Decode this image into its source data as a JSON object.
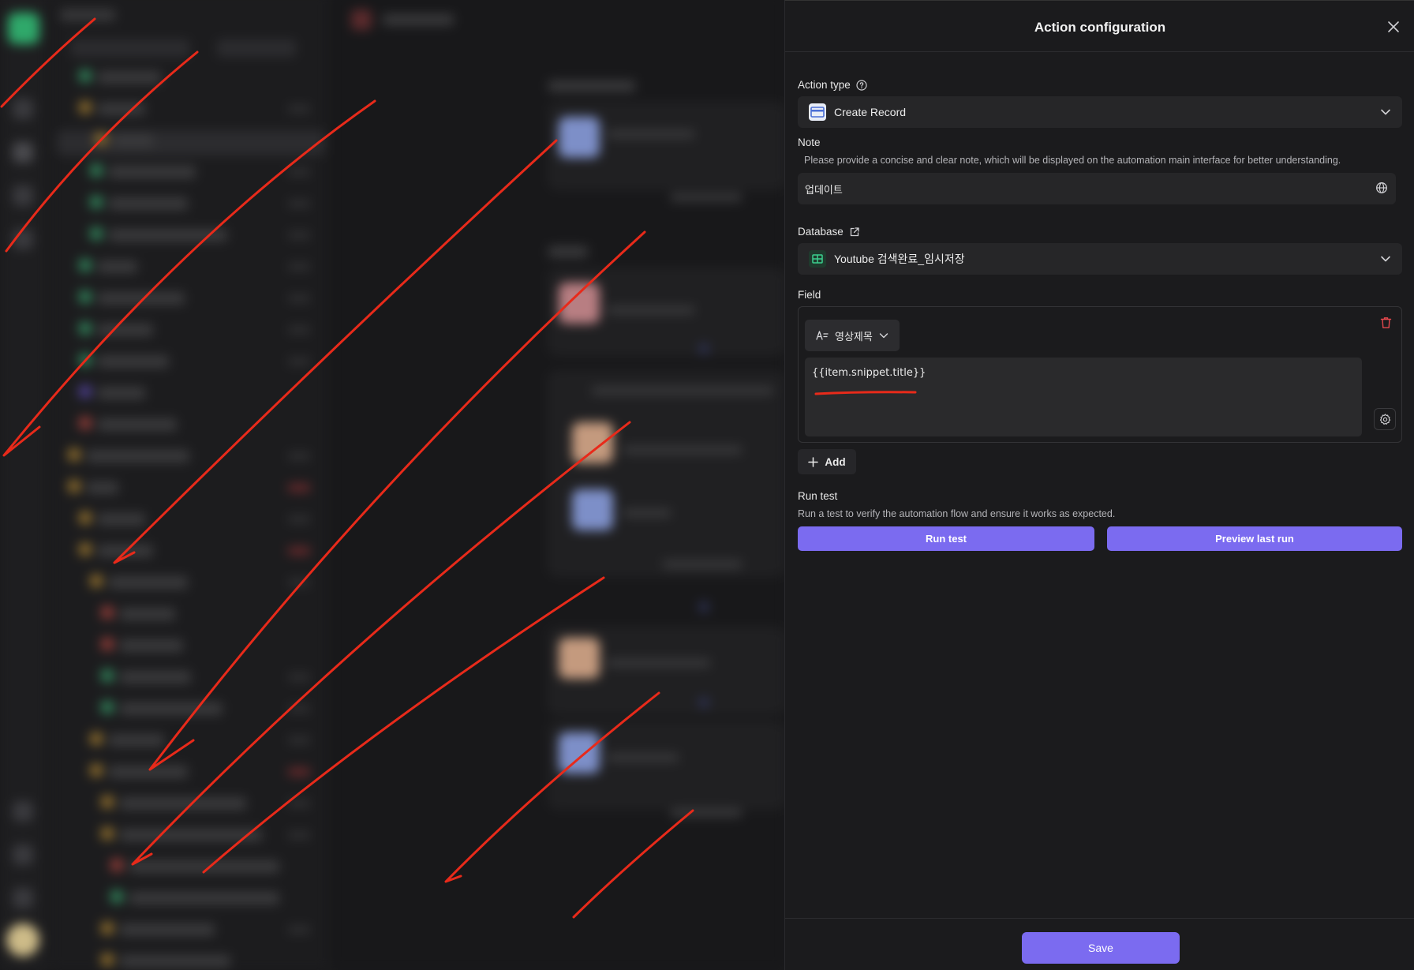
{
  "panel": {
    "title": "Action configuration",
    "action_type": {
      "label": "Action type",
      "value": "Create Record",
      "icon": "record-card-icon"
    },
    "note": {
      "label": "Note",
      "hint": "Please provide a concise and clear note, which will be displayed on the automation main interface for better understanding.",
      "value": "업데이트"
    },
    "database": {
      "label": "Database",
      "value": "Youtube 검색완료_임시저장",
      "icon": "table-grid-icon"
    },
    "field": {
      "label": "Field",
      "field_name": "영상제목",
      "expression": "{{item.snippet.title}}",
      "add_label": "Add"
    },
    "run_test": {
      "label": "Run test",
      "hint": "Run a test to verify the automation flow and ensure it works as expected.",
      "run_button": "Run test",
      "preview_button": "Preview last run"
    },
    "save_button": "Save"
  },
  "colors": {
    "accent": "#7b6bf0",
    "annotation": "#e82a1a",
    "danger": "#e5484d",
    "panel_bg": "#1b1b1d",
    "input_bg": "#262628"
  }
}
